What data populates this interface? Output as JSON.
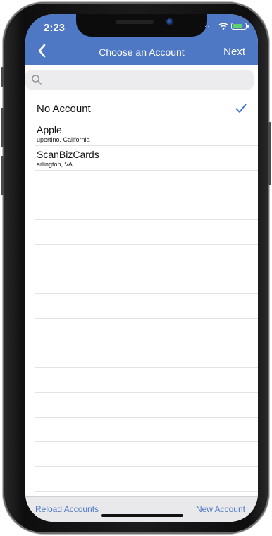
{
  "status_bar": {
    "time": "2:23"
  },
  "nav": {
    "title": "Choose an Account",
    "next_label": "Next",
    "back_icon": "chevron-left-icon"
  },
  "search": {
    "placeholder": "",
    "value": ""
  },
  "accounts": [
    {
      "name": "No Account",
      "location": "",
      "selected": true
    },
    {
      "name": "Apple",
      "location": "upertino, California",
      "selected": false
    },
    {
      "name": "ScanBizCards",
      "location": "arlington, VA",
      "selected": false
    }
  ],
  "toolbar": {
    "reload_label": "Reload Accounts",
    "new_label": "New Account"
  },
  "colors": {
    "accent": "#4f78c4",
    "checkmark": "#3d6fd1"
  }
}
